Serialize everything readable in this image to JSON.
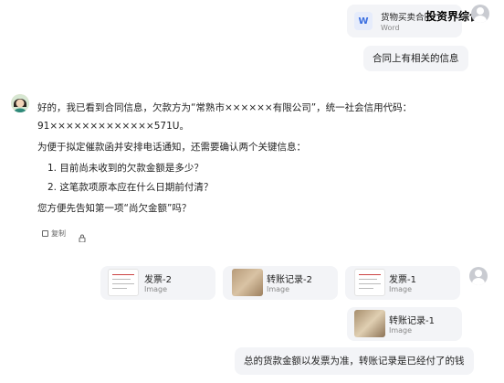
{
  "top_file": {
    "name": "货物买卖合同",
    "type": "Word",
    "icon": "W",
    "overlay_text": "投资界综合"
  },
  "user_msg_1": "合同上有相关的信息",
  "ai": {
    "line1": "好的，我已看到合同信息，欠款方为“常熟市××××××有限公司”，统一社会信用代码：",
    "line2": "91×××××××××××××571U。",
    "line3": "为便于拟定催款函并安排电话通知，还需要确认两个关键信息：",
    "q1": "1. 目前尚未收到的欠款金额是多少？",
    "q2": "2. 这笔款项原本应在什么日期前付清？",
    "line4": "您方便先告知第一项“尚欠金额”吗？",
    "copy_label": "复制"
  },
  "attachments": [
    {
      "name": "发票-2",
      "type": "Image"
    },
    {
      "name": "转账记录-2",
      "type": "Image"
    },
    {
      "name": "发票-1",
      "type": "Image"
    },
    {
      "name": "转账记录-1",
      "type": "Image"
    }
  ],
  "user_msg_2": "总的货款金额以发票为准，转账记录是已经付了的钱",
  "colors": {
    "bubble": "#f3f4f7",
    "word_icon": "#3b6fe0",
    "avatar": "#c9cbd1"
  }
}
